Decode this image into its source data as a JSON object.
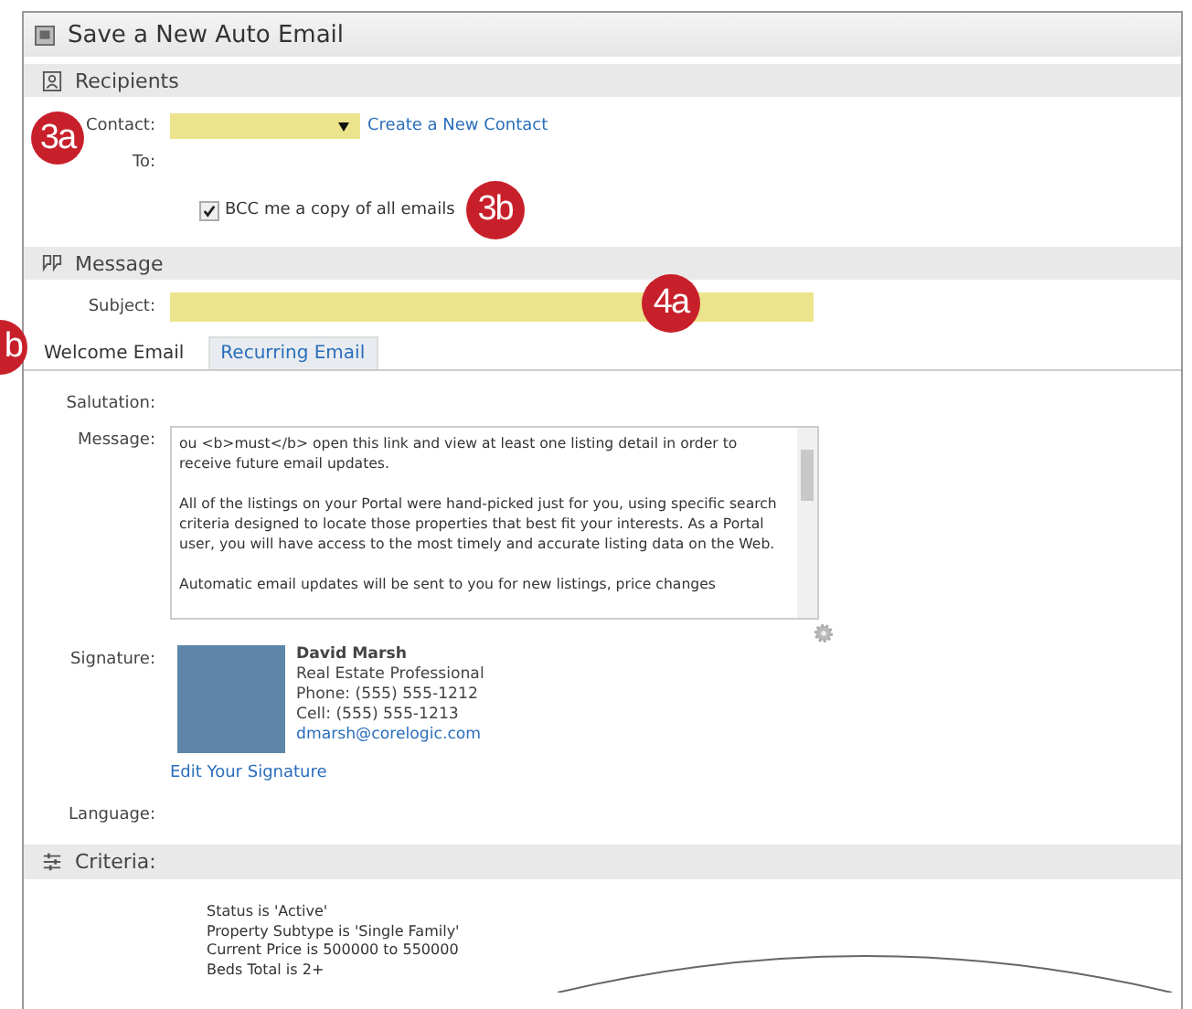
{
  "window": {
    "title": "Save a New Auto Email"
  },
  "recipients": {
    "header": "Recipients",
    "contact_label": "Contact:",
    "contact_callout": "3a",
    "create_link": "Create a New Contact",
    "to_label": "To:",
    "bcc": {
      "label": "BCC me a copy of all emails",
      "checked": true,
      "callout": "3b"
    }
  },
  "message_section": {
    "header": "Message",
    "subject_label": "Subject:",
    "subject_callout": "4a"
  },
  "tabs_callout": "b",
  "tabs": [
    {
      "label": "Welcome Email",
      "selected": true
    },
    {
      "label": "Recurring Email",
      "selected": false
    }
  ],
  "salutation_label": "Salutation:",
  "message": {
    "label": "Message:",
    "paragraphs": [
      "ou <b>must</b> open this link and view at least one listing detail in order to receive future email updates.",
      "All of the listings on your Portal were hand-picked just for you, using specific search criteria designed to locate those properties that best fit your interests.  As a Portal user, you will have access to the most timely and accurate listing data on the Web.",
      "Automatic email updates will be sent to you for new listings, price changes"
    ]
  },
  "signature": {
    "label": "Signature:",
    "name": "David Marsh",
    "lines": [
      "Real Estate Professional",
      "Phone: (555) 555-1212",
      "Cell: (555) 555-1213"
    ],
    "email": "dmarsh@corelogic.com",
    "edit_link": "Edit Your Signature"
  },
  "language_label": "Language:",
  "criteria": {
    "header": "Criteria:",
    "lines": [
      "Status is 'Active'",
      "Property Subtype is 'Single Family'",
      "Current Price is 500000 to 550000",
      "Beds Total is 2+"
    ]
  }
}
